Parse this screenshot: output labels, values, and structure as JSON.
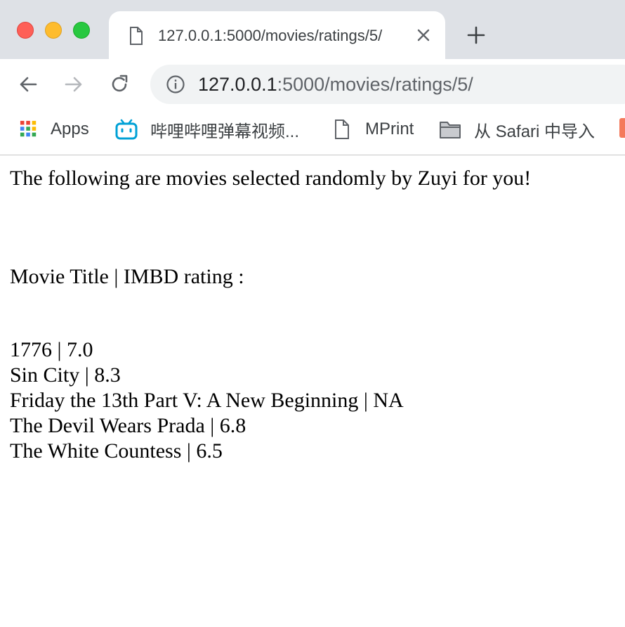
{
  "browser": {
    "tab": {
      "title": "127.0.0.1:5000/movies/ratings/5/"
    },
    "address_bar": {
      "host": "127.0.0.1",
      "path": ":5000/movies/ratings/5/"
    },
    "bookmarks": [
      {
        "label": "Apps",
        "icon": "apps-grid-icon"
      },
      {
        "label": "哔哩哔哩弹幕视频...",
        "icon": "bilibili-icon"
      },
      {
        "label": "MPrint",
        "icon": "page-icon"
      },
      {
        "label": "从 Safari 中导入",
        "icon": "folder-icon"
      }
    ]
  },
  "page": {
    "intro": "The following are movies selected randomly by Zuyi for you!",
    "header": "Movie Title | IMBD rating :",
    "movies": [
      "1776 | 7.0",
      "Sin City | 8.3",
      "Friday the 13th Part V: A New Beginning | NA",
      "The Devil Wears Prada | 6.8",
      "The White Countess | 6.5"
    ]
  },
  "colors": {
    "tabstrip": "#dee1e6",
    "omnibox": "#f1f3f4",
    "close": "#fe5f57",
    "minimize": "#febc2e",
    "zoom": "#28c840"
  }
}
